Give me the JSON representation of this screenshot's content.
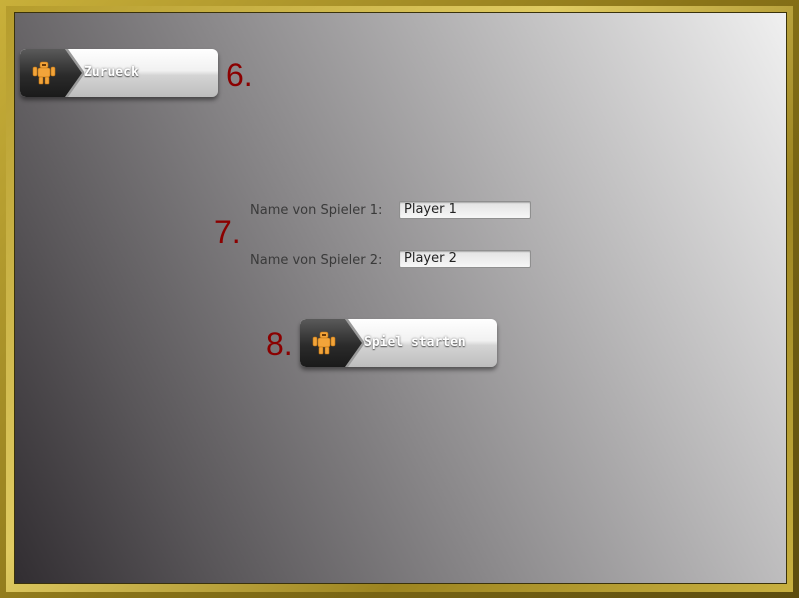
{
  "back_button": {
    "label": "Zurueck",
    "icon": "robot-icon"
  },
  "markers": {
    "back": "6.",
    "names": "7.",
    "start": "8."
  },
  "players": {
    "player1": {
      "label": "Name von Spieler 1:",
      "value": "Player 1"
    },
    "player2": {
      "label": "Name von Spieler 2:",
      "value": "Player 2"
    }
  },
  "start_button": {
    "label": "Spiel starten",
    "icon": "robot-icon"
  },
  "colors": {
    "frame": "#b59c2c",
    "marker": "#8b0000",
    "icon": "#f2a43a"
  }
}
